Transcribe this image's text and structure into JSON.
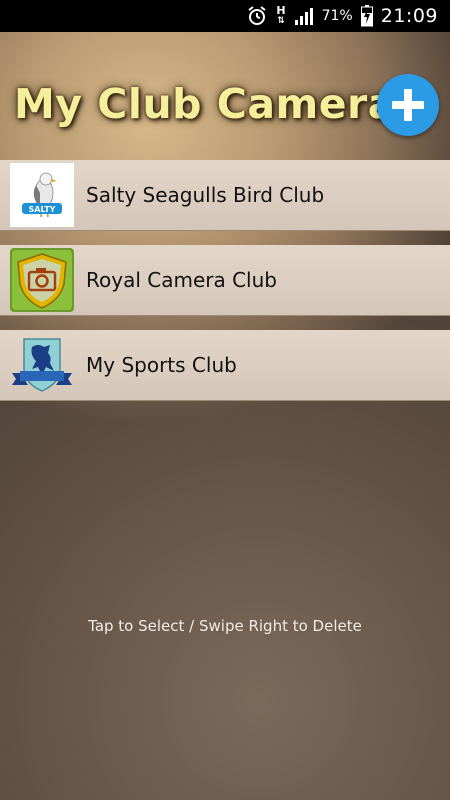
{
  "status_bar": {
    "battery_percent": "71%",
    "time": "21:09",
    "network_label": "H"
  },
  "header": {
    "title": "My Club Camera",
    "add_icon": "plus-icon"
  },
  "clubs": [
    {
      "name": "Salty Seagulls Bird Club",
      "logo_icon": "seagull-logo",
      "logo_text": "SALTY"
    },
    {
      "name": "Royal Camera Club",
      "logo_icon": "camera-shield-logo"
    },
    {
      "name": "My Sports Club",
      "logo_icon": "lion-crest-logo"
    }
  ],
  "hint": "Tap to Select / Swipe Right to Delete",
  "colors": {
    "add_button": "#2b9be6",
    "title": "#f5ee9a",
    "row_bg": "#e3d6c9"
  }
}
